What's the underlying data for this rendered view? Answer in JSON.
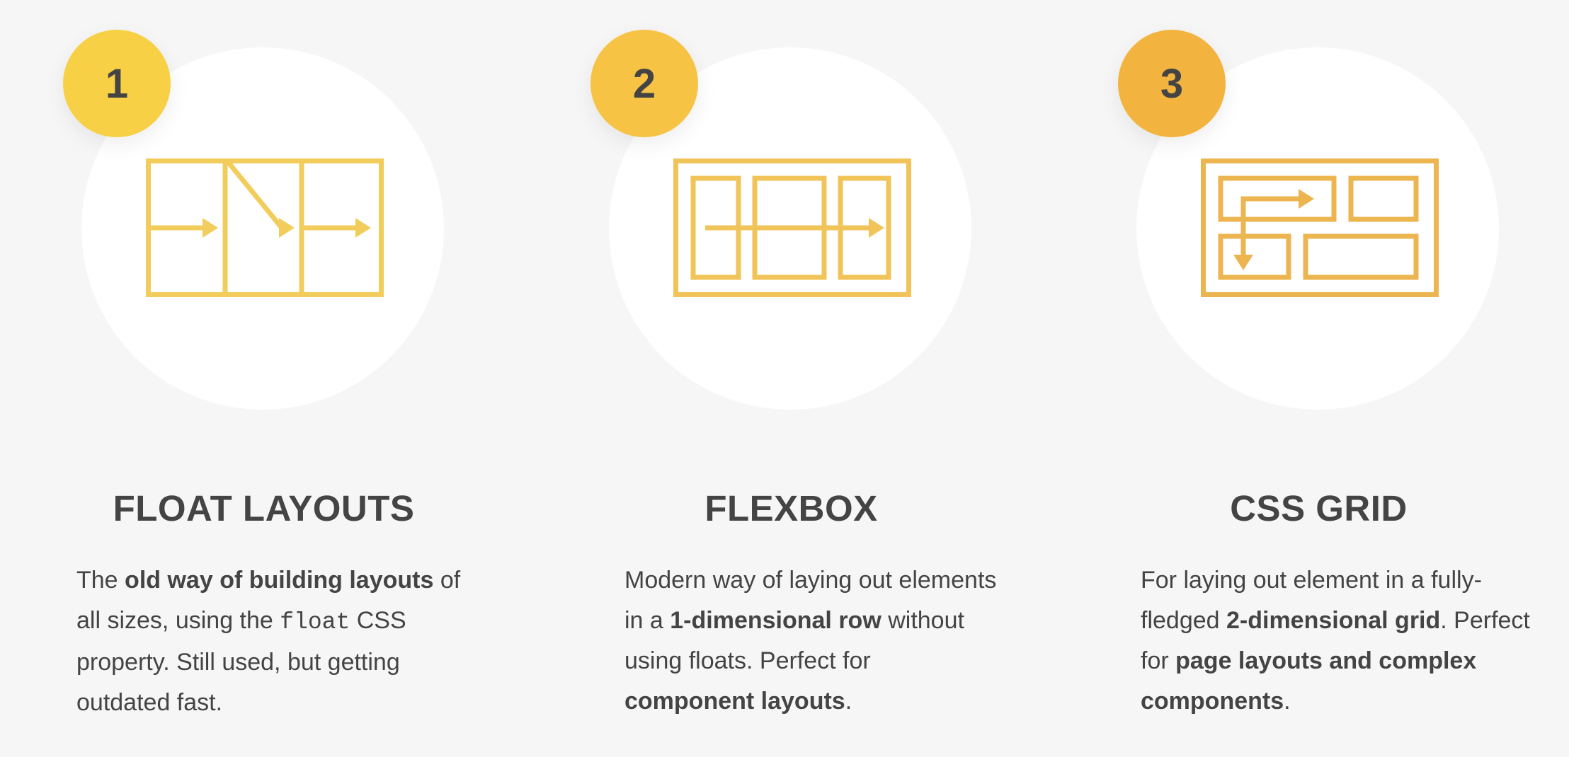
{
  "colors": {
    "background": "#f6f6f6",
    "circle": "#ffffff",
    "badge_1": "#f7d046",
    "badge_2": "#f6c344",
    "badge_3": "#f3b43f",
    "icon_1": "#f2cd5b",
    "icon_2": "#f0c458",
    "icon_3": "#ecb550",
    "text": "#444444"
  },
  "cards": [
    {
      "number": "1",
      "icon": "float-layout-icon",
      "title": "FLOAT LAYOUTS",
      "desc": [
        "The ",
        "old way of building layouts",
        " of all sizes, using the ",
        "float",
        " CSS property. Still used, but getting outdated fast."
      ]
    },
    {
      "number": "2",
      "icon": "flexbox-layout-icon",
      "title": "FLEXBOX",
      "desc": [
        "Modern way of laying out elements in a ",
        "1-dimensional row",
        " without using floats. Perfect for ",
        "component layouts",
        "."
      ]
    },
    {
      "number": "3",
      "icon": "grid-layout-icon",
      "title": "CSS GRID",
      "desc": [
        "For laying out element in a fully-fledged ",
        "2-dimensional grid",
        ". Perfect for ",
        "page layouts and complex components",
        "."
      ]
    }
  ]
}
